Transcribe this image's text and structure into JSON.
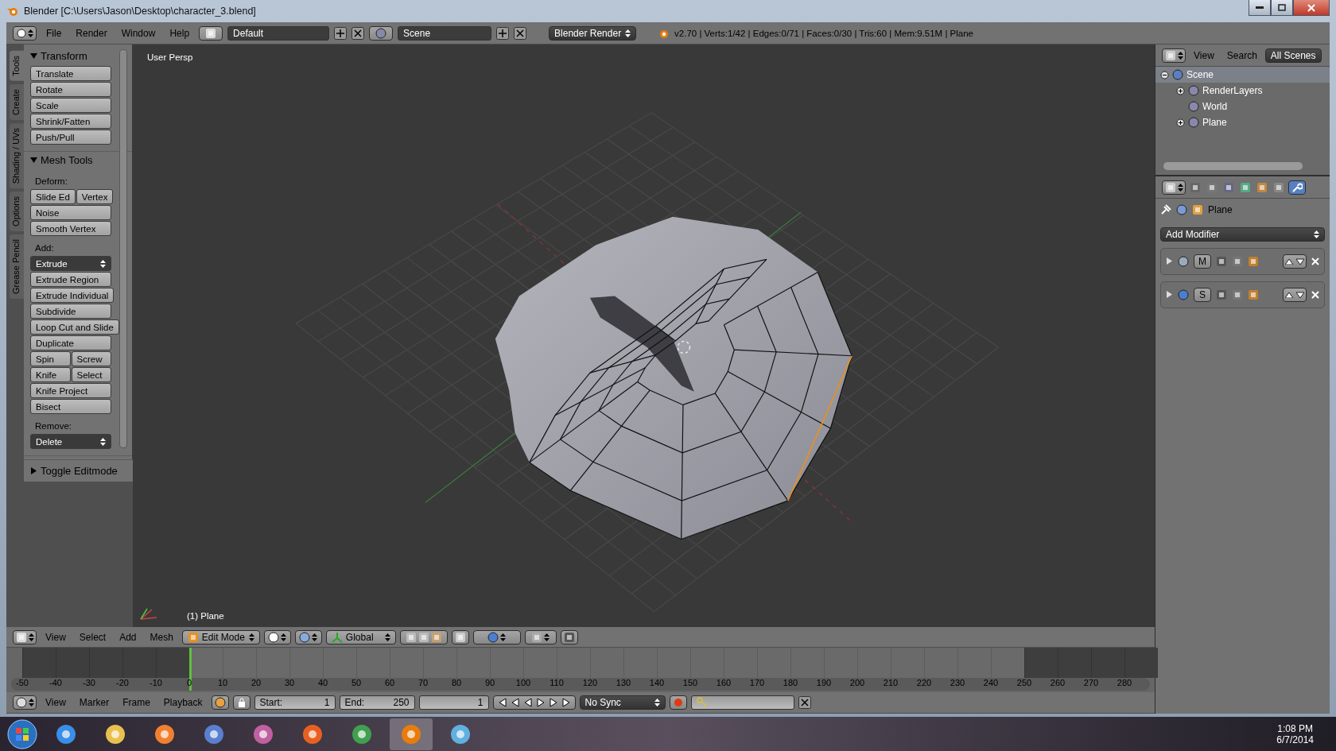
{
  "window": {
    "title": "Blender [C:\\Users\\Jason\\Desktop\\character_3.blend]"
  },
  "info_header": {
    "menus": [
      "File",
      "Render",
      "Window",
      "Help"
    ],
    "layout": "Default",
    "scene": "Scene",
    "engine": "Blender Render",
    "stats": "v2.70 | Verts:1/42 | Edges:0/71 | Faces:0/30 | Tris:60 | Mem:9.51M | Plane"
  },
  "tool_tabs": [
    {
      "label": "Tools",
      "selected": true
    },
    {
      "label": "Create",
      "selected": false
    },
    {
      "label": "Shading / UVs",
      "selected": false
    },
    {
      "label": "Options",
      "selected": false
    },
    {
      "label": "Grease Pencil",
      "selected": false
    }
  ],
  "tool_panels": [
    {
      "title": "Transform",
      "expanded": true,
      "items": [
        {
          "kind": "button",
          "labels": [
            "Translate"
          ]
        },
        {
          "kind": "button",
          "labels": [
            "Rotate"
          ]
        },
        {
          "kind": "button",
          "labels": [
            "Scale"
          ]
        },
        {
          "kind": "button",
          "labels": [
            "Shrink/Fatten"
          ]
        },
        {
          "kind": "button",
          "labels": [
            "Push/Pull"
          ]
        }
      ]
    },
    {
      "title": "Mesh Tools",
      "expanded": true,
      "items": [
        {
          "kind": "label",
          "labels": [
            "Deform:"
          ]
        },
        {
          "kind": "button",
          "labels": [
            "Slide Ed",
            "Vertex"
          ]
        },
        {
          "kind": "button",
          "labels": [
            "Noise"
          ]
        },
        {
          "kind": "button",
          "labels": [
            "Smooth Vertex"
          ]
        },
        {
          "kind": "label",
          "labels": [
            "Add:"
          ]
        },
        {
          "kind": "dropdown",
          "labels": [
            "Extrude"
          ]
        },
        {
          "kind": "button",
          "labels": [
            "Extrude Region"
          ]
        },
        {
          "kind": "button",
          "labels": [
            "Extrude Individual"
          ]
        },
        {
          "kind": "button",
          "labels": [
            "Subdivide"
          ]
        },
        {
          "kind": "button",
          "labels": [
            "Loop Cut and Slide"
          ]
        },
        {
          "kind": "button",
          "labels": [
            "Duplicate"
          ]
        },
        {
          "kind": "button",
          "labels": [
            "Spin",
            "Screw"
          ]
        },
        {
          "kind": "button",
          "labels": [
            "Knife",
            "Select"
          ]
        },
        {
          "kind": "button",
          "labels": [
            "Knife Project"
          ]
        },
        {
          "kind": "button",
          "labels": [
            "Bisect"
          ]
        },
        {
          "kind": "label",
          "labels": [
            "Remove:"
          ]
        },
        {
          "kind": "dropdown",
          "labels": [
            "Delete"
          ]
        }
      ]
    }
  ],
  "operator_panel": {
    "title": "Toggle Editmode",
    "expanded": false
  },
  "viewport": {
    "view_name": "User Persp",
    "object_label": "(1) Plane"
  },
  "view3d_header": {
    "menus": [
      "View",
      "Select",
      "Add",
      "Mesh"
    ],
    "mode": "Edit Mode",
    "orientation": "Global"
  },
  "timeline": {
    "ticks": [
      {
        "label": "-50",
        "in_range": false,
        "playhead": false
      },
      {
        "label": "-40",
        "in_range": false,
        "playhead": false
      },
      {
        "label": "-30",
        "in_range": false,
        "playhead": false
      },
      {
        "label": "-20",
        "in_range": false,
        "playhead": false
      },
      {
        "label": "-10",
        "in_range": false,
        "playhead": false
      },
      {
        "label": "0",
        "in_range": true,
        "playhead": true
      },
      {
        "label": "10",
        "in_range": true,
        "playhead": false
      },
      {
        "label": "20",
        "in_range": true,
        "playhead": false
      },
      {
        "label": "30",
        "in_range": true,
        "playhead": false
      },
      {
        "label": "40",
        "in_range": true,
        "playhead": false
      },
      {
        "label": "50",
        "in_range": true,
        "playhead": false
      },
      {
        "label": "60",
        "in_range": true,
        "playhead": false
      },
      {
        "label": "70",
        "in_range": true,
        "playhead": false
      },
      {
        "label": "80",
        "in_range": true,
        "playhead": false
      },
      {
        "label": "90",
        "in_range": true,
        "playhead": false
      },
      {
        "label": "100",
        "in_range": true,
        "playhead": false
      },
      {
        "label": "110",
        "in_range": true,
        "playhead": false
      },
      {
        "label": "120",
        "in_range": true,
        "playhead": false
      },
      {
        "label": "130",
        "in_range": true,
        "playhead": false
      },
      {
        "label": "140",
        "in_range": true,
        "playhead": false
      },
      {
        "label": "150",
        "in_range": true,
        "playhead": false
      },
      {
        "label": "160",
        "in_range": true,
        "playhead": false
      },
      {
        "label": "170",
        "in_range": true,
        "playhead": false
      },
      {
        "label": "180",
        "in_range": true,
        "playhead": false
      },
      {
        "label": "190",
        "in_range": true,
        "playhead": false
      },
      {
        "label": "200",
        "in_range": true,
        "playhead": false
      },
      {
        "label": "210",
        "in_range": true,
        "playhead": false
      },
      {
        "label": "220",
        "in_range": true,
        "playhead": false
      },
      {
        "label": "230",
        "in_range": true,
        "playhead": false
      },
      {
        "label": "240",
        "in_range": true,
        "playhead": false
      },
      {
        "label": "250",
        "in_range": false,
        "playhead": false
      },
      {
        "label": "260",
        "in_range": false,
        "playhead": false
      },
      {
        "label": "270",
        "in_range": false,
        "playhead": false
      },
      {
        "label": "280",
        "in_range": false,
        "playhead": false
      }
    ]
  },
  "timeline_header": {
    "menus": [
      "View",
      "Marker",
      "Frame",
      "Playback"
    ],
    "start_label": "Start:",
    "start": "1",
    "end_label": "End:",
    "end": "250",
    "current": "1",
    "sync": "No Sync"
  },
  "outliner": {
    "menus": [
      "View",
      "Search"
    ],
    "filter": "All Scenes",
    "tree": [
      {
        "label": "Scene",
        "expanded": true,
        "children": [
          {
            "label": "RenderLayers",
            "expanded": false
          },
          {
            "label": "World"
          },
          {
            "label": "Plane",
            "expanded": false
          }
        ]
      }
    ]
  },
  "properties": {
    "context": "Plane",
    "add_modifier": "Add Modifier",
    "modifiers": [
      {
        "name": "M",
        "expanded": false
      },
      {
        "name": "S",
        "expanded": false
      }
    ]
  },
  "taskbar": {
    "time": "1:08 PM",
    "date": "6/7/2014"
  }
}
